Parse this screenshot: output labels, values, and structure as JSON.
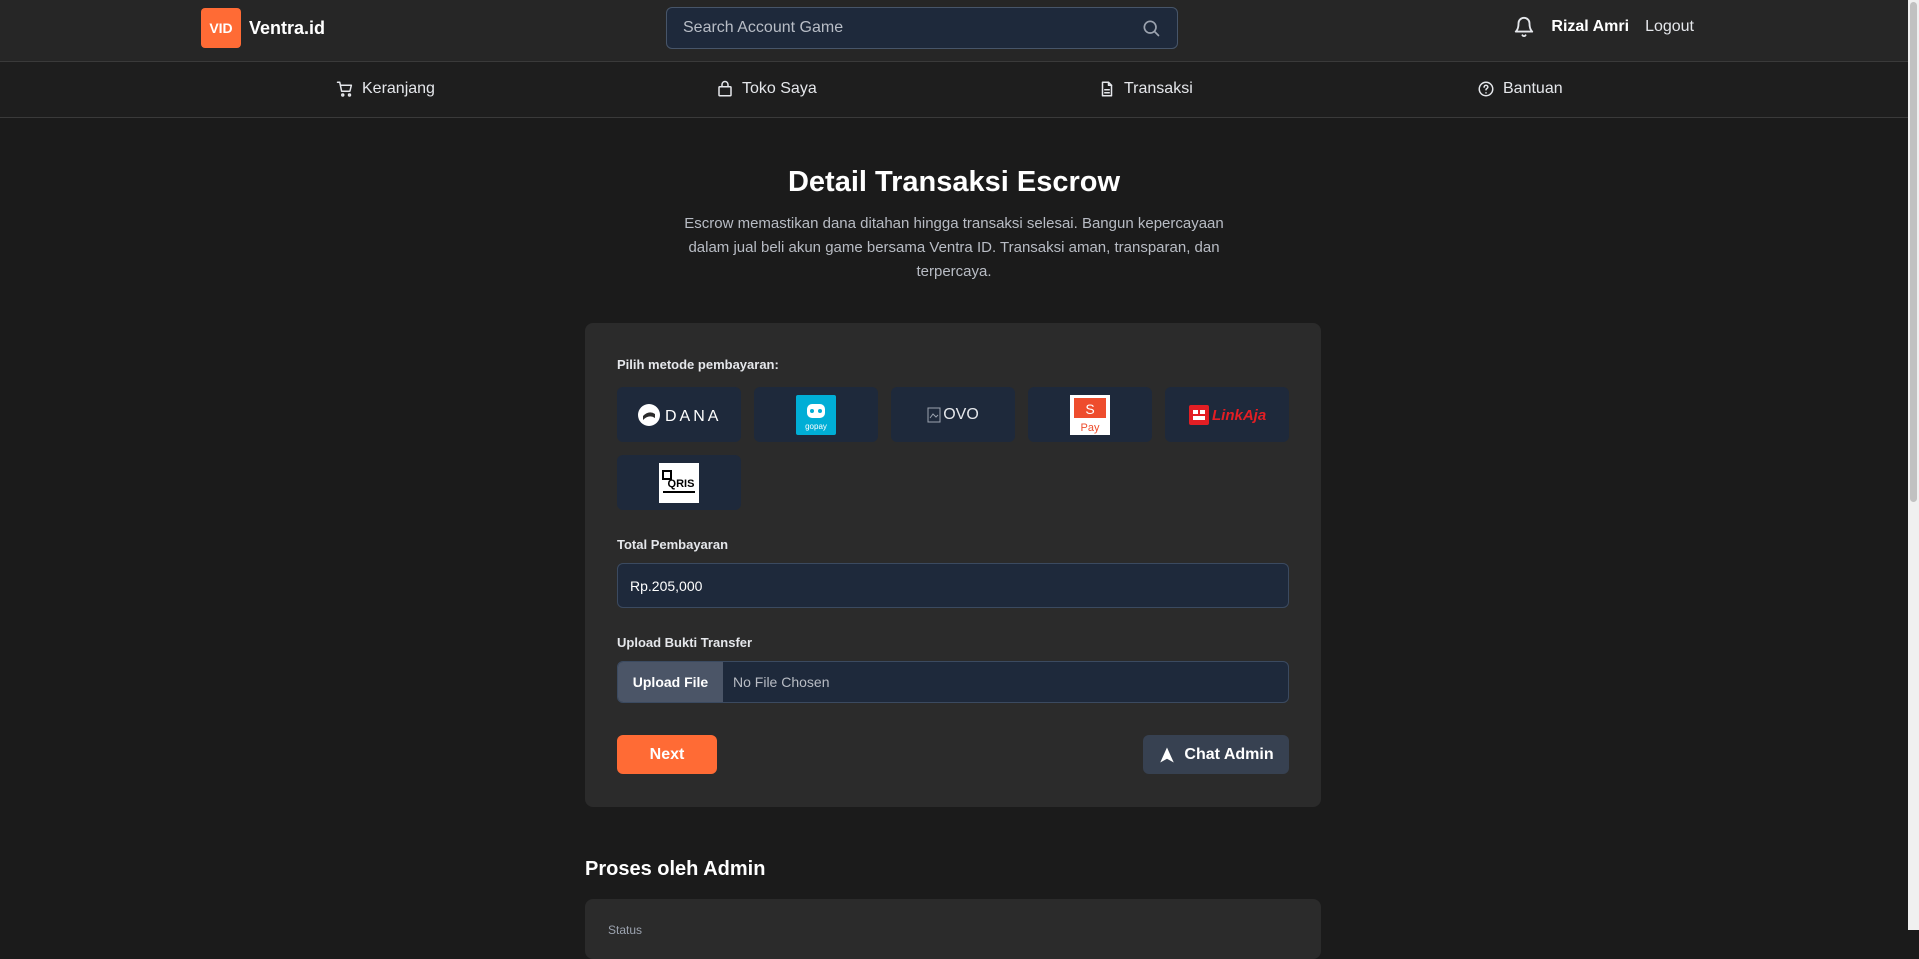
{
  "header": {
    "logo_badge": "VID",
    "logo_name": "Ventra.id",
    "search_placeholder": "Search Account Game",
    "username": "Rizal Amri",
    "logout": "Logout"
  },
  "nav": {
    "items": [
      {
        "label": "Keranjang",
        "icon": "cart-icon"
      },
      {
        "label": "Toko Saya",
        "icon": "bag-icon"
      },
      {
        "label": "Transaksi",
        "icon": "document-icon"
      },
      {
        "label": "Bantuan",
        "icon": "help-circle-icon"
      }
    ]
  },
  "main": {
    "title": "Detail Transaksi Escrow",
    "description": "Escrow memastikan dana ditahan hingga transaksi selesai. Bangun kepercayaan dalam jual beli akun game bersama Ventra ID. Transaksi aman, transparan, dan terpercaya."
  },
  "payment": {
    "label": "Pilih metode pembayaran:",
    "methods": [
      "DANA",
      "gopay",
      "OVO",
      "ShopeePay",
      "LinkAja",
      "QRIS"
    ],
    "ovo_alt": "OVO",
    "dana_text": "DANA",
    "gopay_text": "gopay",
    "spay_text": "Pay",
    "linkaja_text": "LinkAja",
    "qris_text": "QRIS"
  },
  "total": {
    "label": "Total Pembayaran",
    "value": "Rp.205,000"
  },
  "upload": {
    "label": "Upload Bukti Transfer",
    "button": "Upload File",
    "status": "No File Chosen"
  },
  "actions": {
    "next": "Next",
    "chat_admin": "Chat Admin"
  },
  "admin_section": {
    "title": "Proses oleh Admin",
    "status_label": "Status"
  },
  "colors": {
    "accent": "#ff6b35",
    "background": "#1b1b1b",
    "card": "#2b2b2b",
    "field": "#1e293b"
  }
}
